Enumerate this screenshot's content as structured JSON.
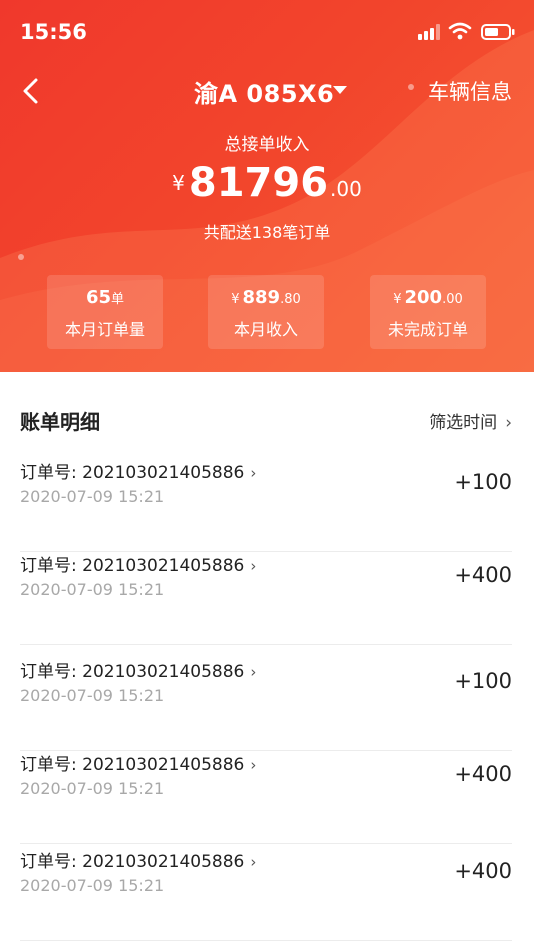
{
  "status_bar": {
    "time": "15:56"
  },
  "nav": {
    "plate": "渝A 085X6",
    "vehicle_info": "车辆信息"
  },
  "summary": {
    "total_label": "总接单收入",
    "currency": "¥",
    "total_integer": "81796",
    "total_decimal": ".00",
    "order_count_text": "共配送138笔订单"
  },
  "stats": [
    {
      "value": "65",
      "unit": "单",
      "label": "本月订单量"
    },
    {
      "currency": "¥",
      "value": "889",
      "decimal": ".80",
      "label": "本月收入"
    },
    {
      "currency": "¥",
      "value": "200",
      "decimal": ".00",
      "label": "未完成订单"
    }
  ],
  "bills": {
    "title": "账单明细",
    "filter_label": "筛选时间",
    "items": [
      {
        "order": "订单号: 202103021405886",
        "date": "2020-07-09 15:21",
        "amount": "+100"
      },
      {
        "order": "订单号: 202103021405886",
        "date": "2020-07-09 15:21",
        "amount": "+400"
      },
      {
        "order": "订单号: 202103021405886",
        "date": "2020-07-09 15:21",
        "amount": "+100"
      },
      {
        "order": "订单号: 202103021405886",
        "date": "2020-07-09 15:21",
        "amount": "+400"
      },
      {
        "order": "订单号: 202103021405886",
        "date": "2020-07-09 15:21",
        "amount": "+400"
      }
    ]
  },
  "colors": {
    "header_red": "#f0382c",
    "header_orange": "#f65a34",
    "date_gray": "#a8a8a8"
  }
}
